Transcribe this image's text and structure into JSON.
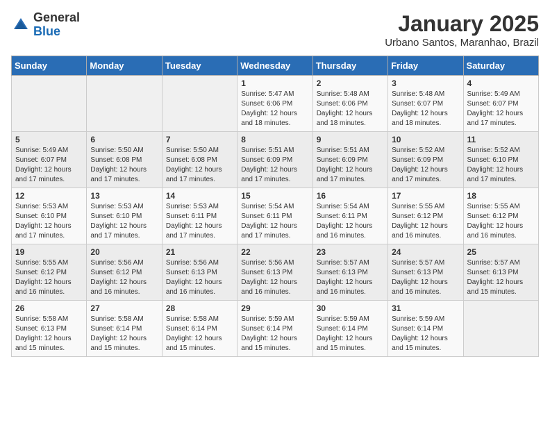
{
  "logo": {
    "general": "General",
    "blue": "Blue"
  },
  "title": "January 2025",
  "subtitle": "Urbano Santos, Maranhao, Brazil",
  "days_of_week": [
    "Sunday",
    "Monday",
    "Tuesday",
    "Wednesday",
    "Thursday",
    "Friday",
    "Saturday"
  ],
  "weeks": [
    [
      {
        "day": "",
        "sunrise": "",
        "sunset": "",
        "daylight": ""
      },
      {
        "day": "",
        "sunrise": "",
        "sunset": "",
        "daylight": ""
      },
      {
        "day": "",
        "sunrise": "",
        "sunset": "",
        "daylight": ""
      },
      {
        "day": "1",
        "sunrise": "Sunrise: 5:47 AM",
        "sunset": "Sunset: 6:06 PM",
        "daylight": "Daylight: 12 hours and 18 minutes."
      },
      {
        "day": "2",
        "sunrise": "Sunrise: 5:48 AM",
        "sunset": "Sunset: 6:06 PM",
        "daylight": "Daylight: 12 hours and 18 minutes."
      },
      {
        "day": "3",
        "sunrise": "Sunrise: 5:48 AM",
        "sunset": "Sunset: 6:07 PM",
        "daylight": "Daylight: 12 hours and 18 minutes."
      },
      {
        "day": "4",
        "sunrise": "Sunrise: 5:49 AM",
        "sunset": "Sunset: 6:07 PM",
        "daylight": "Daylight: 12 hours and 17 minutes."
      }
    ],
    [
      {
        "day": "5",
        "sunrise": "Sunrise: 5:49 AM",
        "sunset": "Sunset: 6:07 PM",
        "daylight": "Daylight: 12 hours and 17 minutes."
      },
      {
        "day": "6",
        "sunrise": "Sunrise: 5:50 AM",
        "sunset": "Sunset: 6:08 PM",
        "daylight": "Daylight: 12 hours and 17 minutes."
      },
      {
        "day": "7",
        "sunrise": "Sunrise: 5:50 AM",
        "sunset": "Sunset: 6:08 PM",
        "daylight": "Daylight: 12 hours and 17 minutes."
      },
      {
        "day": "8",
        "sunrise": "Sunrise: 5:51 AM",
        "sunset": "Sunset: 6:09 PM",
        "daylight": "Daylight: 12 hours and 17 minutes."
      },
      {
        "day": "9",
        "sunrise": "Sunrise: 5:51 AM",
        "sunset": "Sunset: 6:09 PM",
        "daylight": "Daylight: 12 hours and 17 minutes."
      },
      {
        "day": "10",
        "sunrise": "Sunrise: 5:52 AM",
        "sunset": "Sunset: 6:09 PM",
        "daylight": "Daylight: 12 hours and 17 minutes."
      },
      {
        "day": "11",
        "sunrise": "Sunrise: 5:52 AM",
        "sunset": "Sunset: 6:10 PM",
        "daylight": "Daylight: 12 hours and 17 minutes."
      }
    ],
    [
      {
        "day": "12",
        "sunrise": "Sunrise: 5:53 AM",
        "sunset": "Sunset: 6:10 PM",
        "daylight": "Daylight: 12 hours and 17 minutes."
      },
      {
        "day": "13",
        "sunrise": "Sunrise: 5:53 AM",
        "sunset": "Sunset: 6:10 PM",
        "daylight": "Daylight: 12 hours and 17 minutes."
      },
      {
        "day": "14",
        "sunrise": "Sunrise: 5:53 AM",
        "sunset": "Sunset: 6:11 PM",
        "daylight": "Daylight: 12 hours and 17 minutes."
      },
      {
        "day": "15",
        "sunrise": "Sunrise: 5:54 AM",
        "sunset": "Sunset: 6:11 PM",
        "daylight": "Daylight: 12 hours and 17 minutes."
      },
      {
        "day": "16",
        "sunrise": "Sunrise: 5:54 AM",
        "sunset": "Sunset: 6:11 PM",
        "daylight": "Daylight: 12 hours and 16 minutes."
      },
      {
        "day": "17",
        "sunrise": "Sunrise: 5:55 AM",
        "sunset": "Sunset: 6:12 PM",
        "daylight": "Daylight: 12 hours and 16 minutes."
      },
      {
        "day": "18",
        "sunrise": "Sunrise: 5:55 AM",
        "sunset": "Sunset: 6:12 PM",
        "daylight": "Daylight: 12 hours and 16 minutes."
      }
    ],
    [
      {
        "day": "19",
        "sunrise": "Sunrise: 5:55 AM",
        "sunset": "Sunset: 6:12 PM",
        "daylight": "Daylight: 12 hours and 16 minutes."
      },
      {
        "day": "20",
        "sunrise": "Sunrise: 5:56 AM",
        "sunset": "Sunset: 6:12 PM",
        "daylight": "Daylight: 12 hours and 16 minutes."
      },
      {
        "day": "21",
        "sunrise": "Sunrise: 5:56 AM",
        "sunset": "Sunset: 6:13 PM",
        "daylight": "Daylight: 12 hours and 16 minutes."
      },
      {
        "day": "22",
        "sunrise": "Sunrise: 5:56 AM",
        "sunset": "Sunset: 6:13 PM",
        "daylight": "Daylight: 12 hours and 16 minutes."
      },
      {
        "day": "23",
        "sunrise": "Sunrise: 5:57 AM",
        "sunset": "Sunset: 6:13 PM",
        "daylight": "Daylight: 12 hours and 16 minutes."
      },
      {
        "day": "24",
        "sunrise": "Sunrise: 5:57 AM",
        "sunset": "Sunset: 6:13 PM",
        "daylight": "Daylight: 12 hours and 16 minutes."
      },
      {
        "day": "25",
        "sunrise": "Sunrise: 5:57 AM",
        "sunset": "Sunset: 6:13 PM",
        "daylight": "Daylight: 12 hours and 15 minutes."
      }
    ],
    [
      {
        "day": "26",
        "sunrise": "Sunrise: 5:58 AM",
        "sunset": "Sunset: 6:13 PM",
        "daylight": "Daylight: 12 hours and 15 minutes."
      },
      {
        "day": "27",
        "sunrise": "Sunrise: 5:58 AM",
        "sunset": "Sunset: 6:14 PM",
        "daylight": "Daylight: 12 hours and 15 minutes."
      },
      {
        "day": "28",
        "sunrise": "Sunrise: 5:58 AM",
        "sunset": "Sunset: 6:14 PM",
        "daylight": "Daylight: 12 hours and 15 minutes."
      },
      {
        "day": "29",
        "sunrise": "Sunrise: 5:59 AM",
        "sunset": "Sunset: 6:14 PM",
        "daylight": "Daylight: 12 hours and 15 minutes."
      },
      {
        "day": "30",
        "sunrise": "Sunrise: 5:59 AM",
        "sunset": "Sunset: 6:14 PM",
        "daylight": "Daylight: 12 hours and 15 minutes."
      },
      {
        "day": "31",
        "sunrise": "Sunrise: 5:59 AM",
        "sunset": "Sunset: 6:14 PM",
        "daylight": "Daylight: 12 hours and 15 minutes."
      },
      {
        "day": "",
        "sunrise": "",
        "sunset": "",
        "daylight": ""
      }
    ]
  ]
}
